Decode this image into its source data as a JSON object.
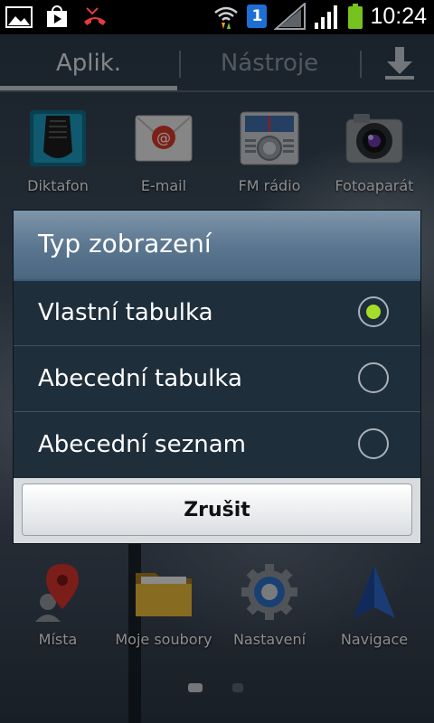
{
  "status_bar": {
    "time": "10:24",
    "sim_badge": "1",
    "icons": [
      "gallery-icon",
      "play-store-icon",
      "missed-call-icon",
      "wifi-icon",
      "signal-icon",
      "signal-icon-2",
      "battery-icon"
    ]
  },
  "tabs": {
    "apps_label": "Aplik.",
    "tools_label": "Nástroje",
    "download_icon": "download-icon",
    "active": "apps"
  },
  "apps_top": [
    {
      "label": "Diktafon",
      "icon": "voice-recorder-icon"
    },
    {
      "label": "E-mail",
      "icon": "email-icon"
    },
    {
      "label": "FM rádio",
      "icon": "fm-radio-icon"
    },
    {
      "label": "Fotoaparát",
      "icon": "camera-icon"
    }
  ],
  "apps_bottom": [
    {
      "label": "Místa",
      "icon": "places-icon"
    },
    {
      "label": "Moje soubory",
      "icon": "folder-icon"
    },
    {
      "label": "Nastavení",
      "icon": "settings-icon"
    },
    {
      "label": "Navigace",
      "icon": "navigation-icon"
    }
  ],
  "dialog": {
    "title": "Typ zobrazení",
    "options": [
      {
        "label": "Vlastní tabulka",
        "selected": true
      },
      {
        "label": "Abecední tabulka",
        "selected": false
      },
      {
        "label": "Abecední seznam",
        "selected": false
      }
    ],
    "cancel_label": "Zrušit"
  },
  "colors": {
    "accent_green": "#a6dc2a",
    "battery_green": "#76c21f",
    "dialog_bg": "#1f2e3b",
    "title_bar": "#5c7790"
  }
}
